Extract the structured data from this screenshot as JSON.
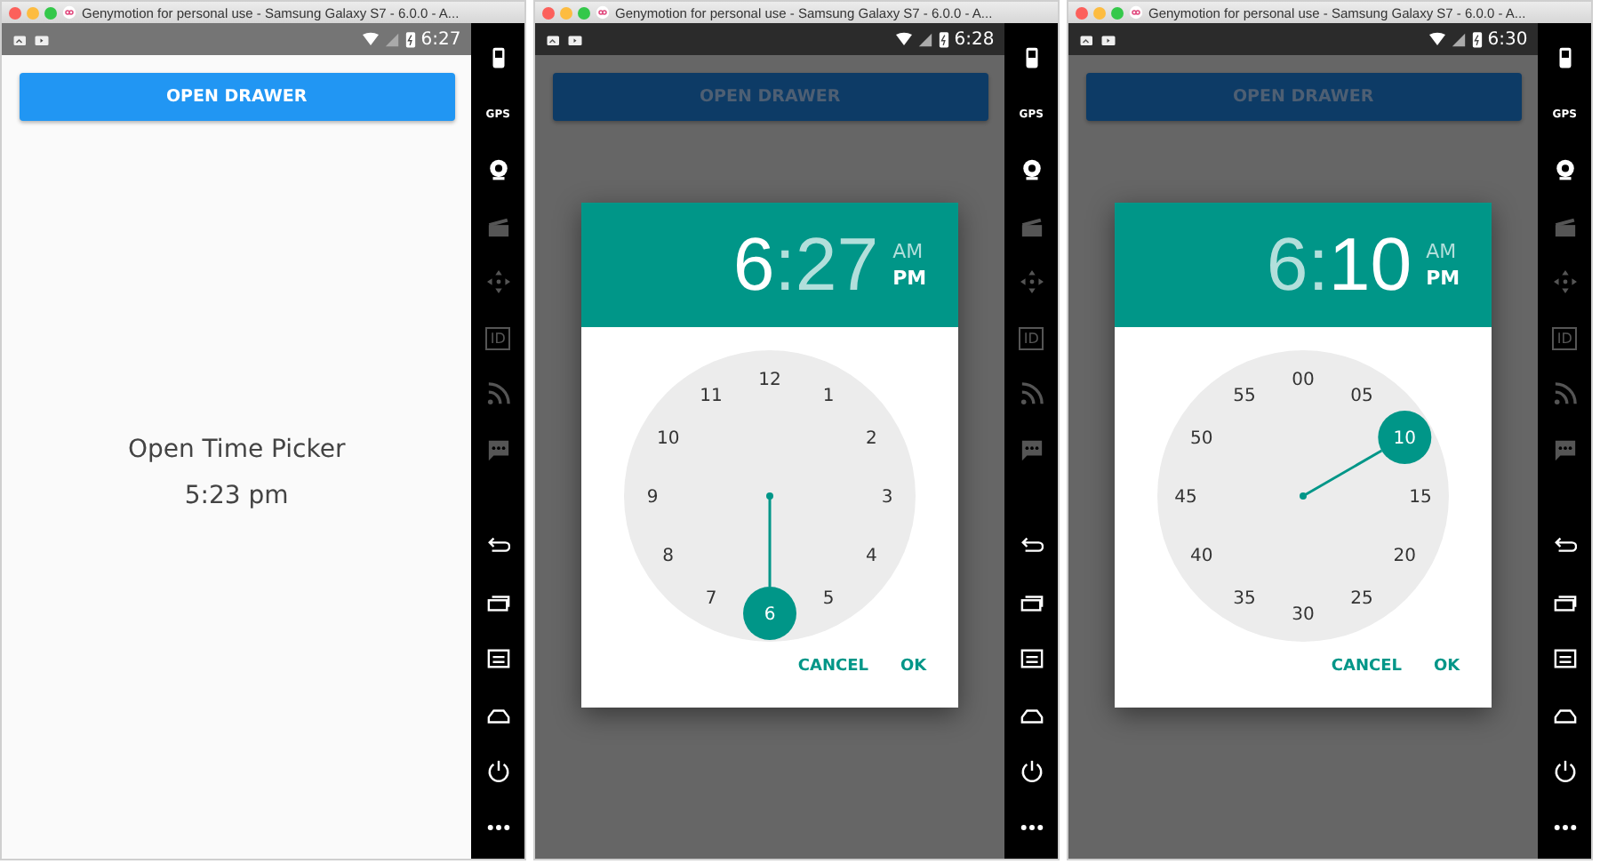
{
  "windows": [
    {
      "title": "Genymotion for personal use - Samsung Galaxy S7 - 6.0.0 - A...",
      "status_time": "6:27",
      "screen": {
        "kind": "main",
        "button": "OPEN DRAWER",
        "label": "Open Time Picker",
        "value": "5:23 pm"
      },
      "sidebar": [
        {
          "kind": "battery",
          "enabled": true
        },
        {
          "kind": "gps",
          "label": "GPS",
          "enabled": true
        },
        {
          "kind": "webcam",
          "enabled": true
        },
        {
          "kind": "clapper",
          "enabled": false
        },
        {
          "kind": "move",
          "enabled": false
        },
        {
          "kind": "id",
          "label": "ID",
          "enabled": false
        },
        {
          "kind": "rss",
          "enabled": false
        },
        {
          "kind": "sms",
          "enabled": false
        },
        {
          "kind": "back",
          "enabled": true
        },
        {
          "kind": "recents",
          "enabled": true
        },
        {
          "kind": "menu",
          "enabled": true
        },
        {
          "kind": "home",
          "enabled": true
        },
        {
          "kind": "power",
          "enabled": true
        },
        {
          "kind": "more",
          "enabled": true
        }
      ]
    },
    {
      "title": "Genymotion for personal use - Samsung Galaxy S7 - 6.0.0 - A...",
      "status_time": "6:28",
      "screen": {
        "kind": "time-picker",
        "button": "OPEN DRAWER",
        "hour": {
          "text": "6",
          "active": true
        },
        "separator": ":",
        "minute": {
          "text": "27",
          "active": false
        },
        "periods": [
          {
            "label": "AM",
            "selected": false
          },
          {
            "label": "PM",
            "selected": true
          }
        ],
        "dial": [
          {
            "label": "12",
            "selected": false
          },
          {
            "label": "1",
            "selected": false
          },
          {
            "label": "2",
            "selected": false
          },
          {
            "label": "3",
            "selected": false
          },
          {
            "label": "4",
            "selected": false
          },
          {
            "label": "5",
            "selected": false
          },
          {
            "label": "6",
            "selected": true
          },
          {
            "label": "7",
            "selected": false
          },
          {
            "label": "8",
            "selected": false
          },
          {
            "label": "9",
            "selected": false
          },
          {
            "label": "10",
            "selected": false
          },
          {
            "label": "11",
            "selected": false
          }
        ],
        "actions": [
          "CANCEL",
          "OK"
        ]
      },
      "sidebar": [
        {
          "kind": "battery",
          "enabled": true
        },
        {
          "kind": "gps",
          "label": "GPS",
          "enabled": true
        },
        {
          "kind": "webcam",
          "enabled": true
        },
        {
          "kind": "clapper",
          "enabled": false
        },
        {
          "kind": "move",
          "enabled": false
        },
        {
          "kind": "id",
          "label": "ID",
          "enabled": false
        },
        {
          "kind": "rss",
          "enabled": false
        },
        {
          "kind": "sms",
          "enabled": false
        },
        {
          "kind": "back",
          "enabled": true
        },
        {
          "kind": "recents",
          "enabled": true
        },
        {
          "kind": "menu",
          "enabled": true
        },
        {
          "kind": "home",
          "enabled": true
        },
        {
          "kind": "power",
          "enabled": true
        },
        {
          "kind": "more",
          "enabled": true
        }
      ]
    },
    {
      "title": "Genymotion for personal use - Samsung Galaxy S7 - 6.0.0 - A...",
      "status_time": "6:30",
      "screen": {
        "kind": "time-picker",
        "button": "OPEN DRAWER",
        "hour": {
          "text": "6",
          "active": false
        },
        "separator": ":",
        "minute": {
          "text": "10",
          "active": true
        },
        "periods": [
          {
            "label": "AM",
            "selected": false
          },
          {
            "label": "PM",
            "selected": true
          }
        ],
        "dial": [
          {
            "label": "00",
            "selected": false
          },
          {
            "label": "05",
            "selected": false
          },
          {
            "label": "10",
            "selected": true
          },
          {
            "label": "15",
            "selected": false
          },
          {
            "label": "20",
            "selected": false
          },
          {
            "label": "25",
            "selected": false
          },
          {
            "label": "30",
            "selected": false
          },
          {
            "label": "35",
            "selected": false
          },
          {
            "label": "40",
            "selected": false
          },
          {
            "label": "45",
            "selected": false
          },
          {
            "label": "50",
            "selected": false
          },
          {
            "label": "55",
            "selected": false
          }
        ],
        "actions": [
          "CANCEL",
          "OK"
        ]
      },
      "sidebar": [
        {
          "kind": "battery",
          "enabled": true
        },
        {
          "kind": "gps",
          "label": "GPS",
          "enabled": true
        },
        {
          "kind": "webcam",
          "enabled": true
        },
        {
          "kind": "clapper",
          "enabled": false
        },
        {
          "kind": "move",
          "enabled": false
        },
        {
          "kind": "id",
          "label": "ID",
          "enabled": false
        },
        {
          "kind": "rss",
          "enabled": false
        },
        {
          "kind": "sms",
          "enabled": false
        },
        {
          "kind": "back",
          "enabled": true
        },
        {
          "kind": "recents",
          "enabled": true
        },
        {
          "kind": "menu",
          "enabled": true
        },
        {
          "kind": "home",
          "enabled": true
        },
        {
          "kind": "power",
          "enabled": true
        },
        {
          "kind": "more",
          "enabled": true
        }
      ]
    }
  ]
}
